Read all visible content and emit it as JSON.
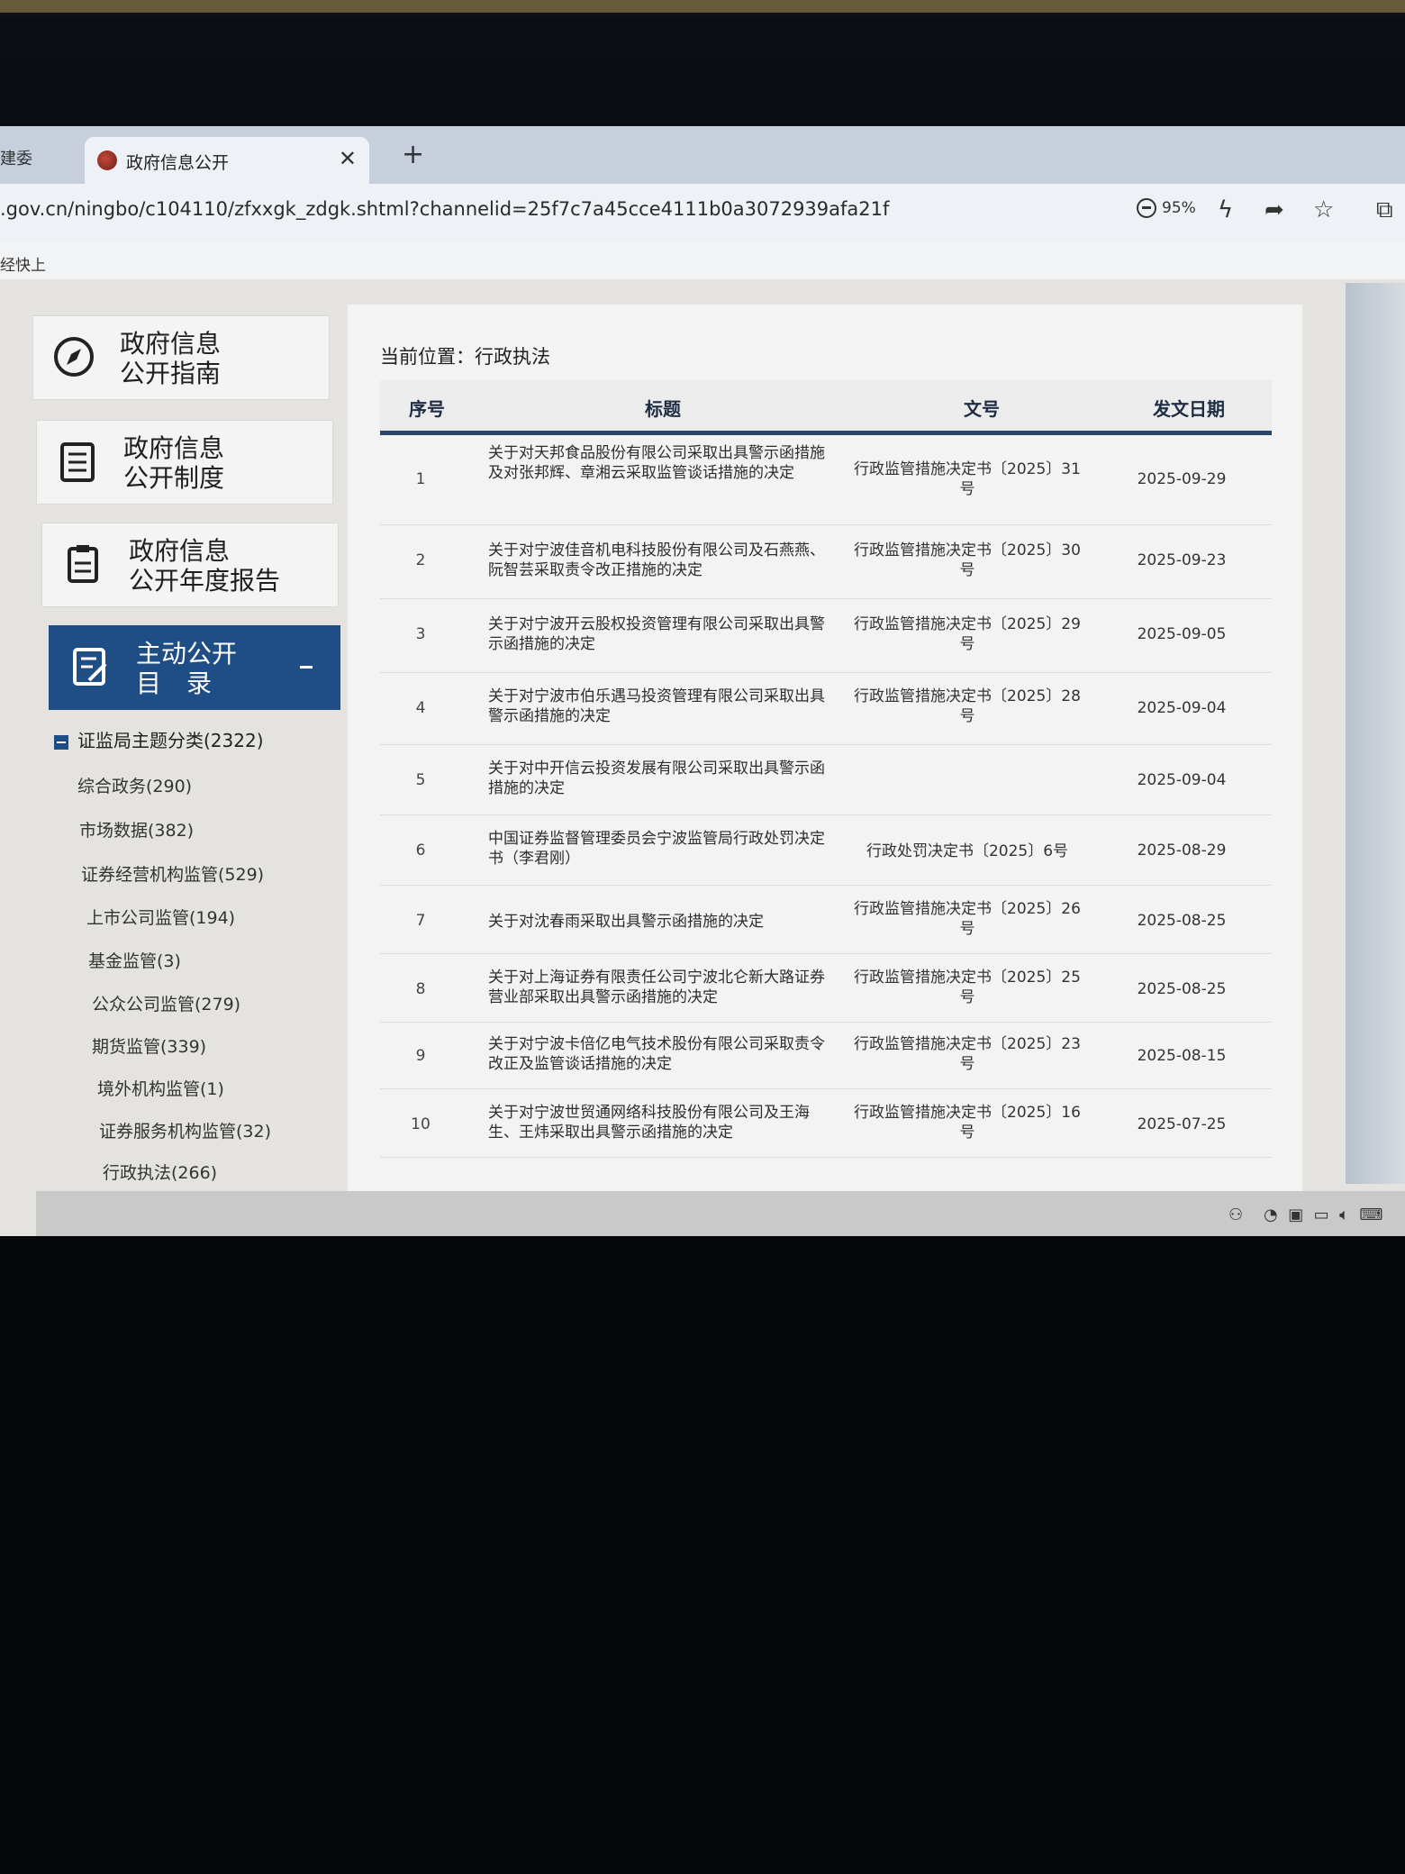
{
  "browser": {
    "prev_tab_label": "建委",
    "active_tab_title": "政府信息公开",
    "new_tab": "+",
    "url": ".gov.cn/ningbo/c104110/zfxxgk_zdgk.shtml?channelid=25f7c7a45cce4111b0a3072939afa21f",
    "zoom": "95%",
    "bookmark_text": "经快上"
  },
  "nav": {
    "items": [
      {
        "line1": "政府信息",
        "line2": "公开指南",
        "icon": "compass-icon"
      },
      {
        "line1": "政府信息",
        "line2": "公开制度",
        "icon": "list-icon"
      },
      {
        "line1": "政府信息",
        "line2": "公开年度报告",
        "icon": "clipboard-icon"
      },
      {
        "line1": "主动公开",
        "line2": "目　录",
        "icon": "edit-doc-icon"
      }
    ],
    "tree_root": "证监局主题分类(2322)",
    "tree_items": [
      "综合政务(290)",
      "市场数据(382)",
      "证券经营机构监管(529)",
      "上市公司监管(194)",
      "基金监管(3)",
      "公众公司监管(279)",
      "期货监管(339)",
      "境外机构监管(1)",
      "证券服务机构监管(32)",
      "行政执法(266)"
    ]
  },
  "content": {
    "breadcrumb": "当前位置：行政执法",
    "headers": {
      "no": "序号",
      "title": "标题",
      "doc": "文号",
      "date": "发文日期"
    },
    "rows": [
      {
        "no": "1",
        "title": "关于对天邦食品股份有限公司采取出具警示函措施及对张邦辉、章湘云采取监管谈话措施的决定",
        "doc": "行政监管措施决定书〔2025〕31号",
        "date": "2025-09-29"
      },
      {
        "no": "2",
        "title": "关于对宁波佳音机电科技股份有限公司及石燕燕、阮智芸采取责令改正措施的决定",
        "doc": "行政监管措施决定书〔2025〕30号",
        "date": "2025-09-23"
      },
      {
        "no": "3",
        "title": "关于对宁波开云股权投资管理有限公司采取出具警示函措施的决定",
        "doc": "行政监管措施决定书〔2025〕29号",
        "date": "2025-09-05"
      },
      {
        "no": "4",
        "title": "关于对宁波市伯乐遇马投资管理有限公司采取出具警示函措施的决定",
        "doc": "行政监管措施决定书〔2025〕28号",
        "date": "2025-09-04"
      },
      {
        "no": "5",
        "title": "关于对中开信云投资发展有限公司采取出具警示函措施的决定",
        "doc": "",
        "date": "2025-09-04"
      },
      {
        "no": "6",
        "title": "中国证券监督管理委员会宁波监管局行政处罚决定书（李君刚）",
        "doc": "行政处罚决定书〔2025〕6号",
        "date": "2025-08-29"
      },
      {
        "no": "7",
        "title": "关于对沈春雨采取出具警示函措施的决定",
        "doc": "行政监管措施决定书〔2025〕26号",
        "date": "2025-08-25"
      },
      {
        "no": "8",
        "title": "关于对上海证券有限责任公司宁波北仑新大路证券营业部采取出具警示函措施的决定",
        "doc": "行政监管措施决定书〔2025〕25号",
        "date": "2025-08-25"
      },
      {
        "no": "9",
        "title": "关于对宁波卡倍亿电气技术股份有限公司采取责令改正及监管谈话措施的决定",
        "doc": "行政监管措施决定书〔2025〕23号",
        "date": "2025-08-15"
      },
      {
        "no": "10",
        "title": "关于对宁波世贸通网络科技股份有限公司及王海生、王炜采取出具警示函措施的决定",
        "doc": "行政监管措施决定书〔2025〕16号",
        "date": "2025-07-25"
      }
    ]
  },
  "colors": {
    "nav_active": "#1f4e86",
    "table_rule": "#2c466a"
  }
}
